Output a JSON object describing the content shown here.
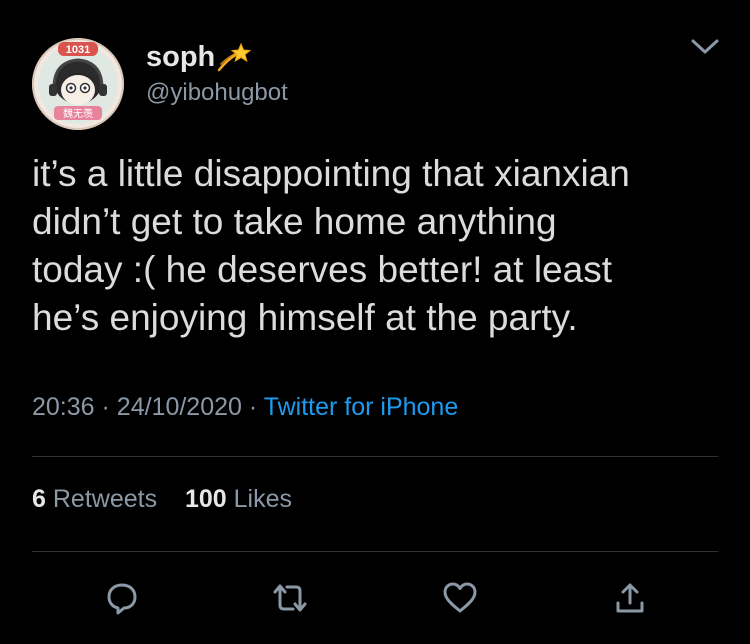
{
  "author": {
    "name": "soph",
    "handle": "@yibohugbot",
    "name_emoji_icon": "dizzy-icon",
    "avatar_badge_text": "1031",
    "avatar_caption_text": "魏无羡"
  },
  "tweet": {
    "text": "it’s a little disappointing that xianxian\ndidn’t get to take home anything\ntoday :( he deserves better! at least\nhe’s enjoying himself at the party.",
    "time": "20:36",
    "separator": "·",
    "date": "24/10/2020",
    "source": "Twitter for iPhone"
  },
  "stats": {
    "retweets_count": "6",
    "retweets_label": "Retweets",
    "likes_count": "100",
    "likes_label": "Likes"
  },
  "actions": [
    {
      "icon": "reply-icon"
    },
    {
      "icon": "retweet-icon"
    },
    {
      "icon": "like-icon"
    },
    {
      "icon": "share-icon"
    }
  ],
  "colors": {
    "background": "#000000",
    "text": "#dcdcdc",
    "secondary": "#8b98a5",
    "link": "#1d9bf0",
    "divider": "#2f3336"
  }
}
